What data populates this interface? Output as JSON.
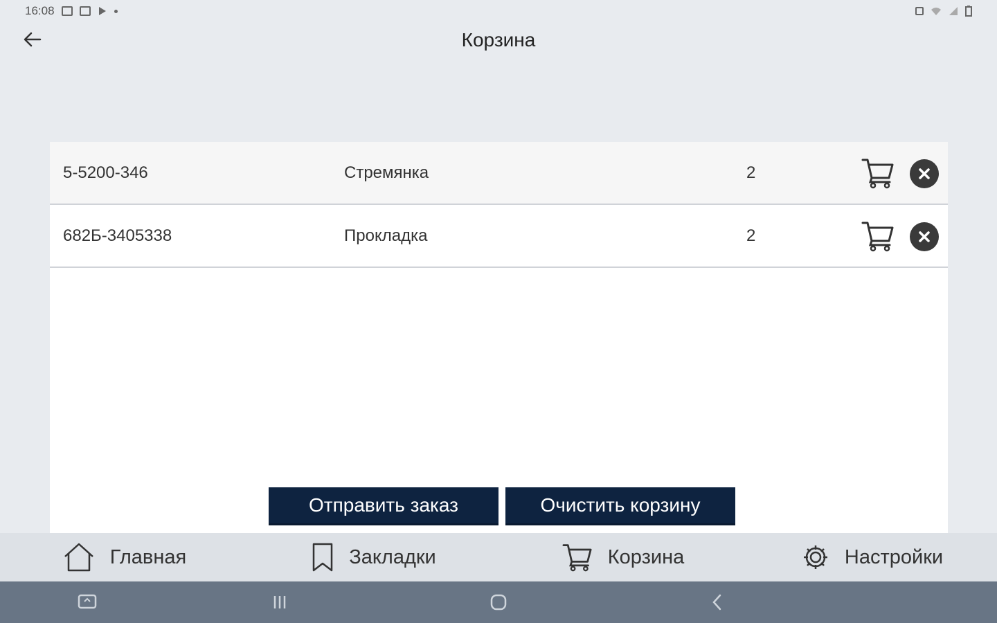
{
  "status_bar": {
    "time": "16:08",
    "left_icons": [
      "gallery-icon",
      "message-icon",
      "play-icon",
      "dot-icon"
    ],
    "right_icons": [
      "alarm-icon",
      "wifi-icon",
      "signal-icon",
      "battery-icon"
    ]
  },
  "header": {
    "title": "Корзина",
    "back_icon": "arrow-left-icon"
  },
  "cart": {
    "items": [
      {
        "code": "5-5200-346",
        "name": "Стремянка",
        "qty": "2"
      },
      {
        "code": "682Б-3405338",
        "name": "Прокладка",
        "qty": "2"
      }
    ],
    "send_label": "Отправить заказ",
    "clear_label": "Очистить корзину"
  },
  "bottom_nav": {
    "items": [
      {
        "label": "Главная",
        "icon": "home-icon"
      },
      {
        "label": "Закладки",
        "icon": "bookmark-icon"
      },
      {
        "label": "Корзина",
        "icon": "cart-icon"
      },
      {
        "label": "Настройки",
        "icon": "gear-icon"
      }
    ]
  },
  "colors": {
    "background": "#e8ebef",
    "panel": "#ffffff",
    "button": "#0e2340",
    "bottom_nav": "#dde1e6",
    "system_nav": "#687585"
  }
}
